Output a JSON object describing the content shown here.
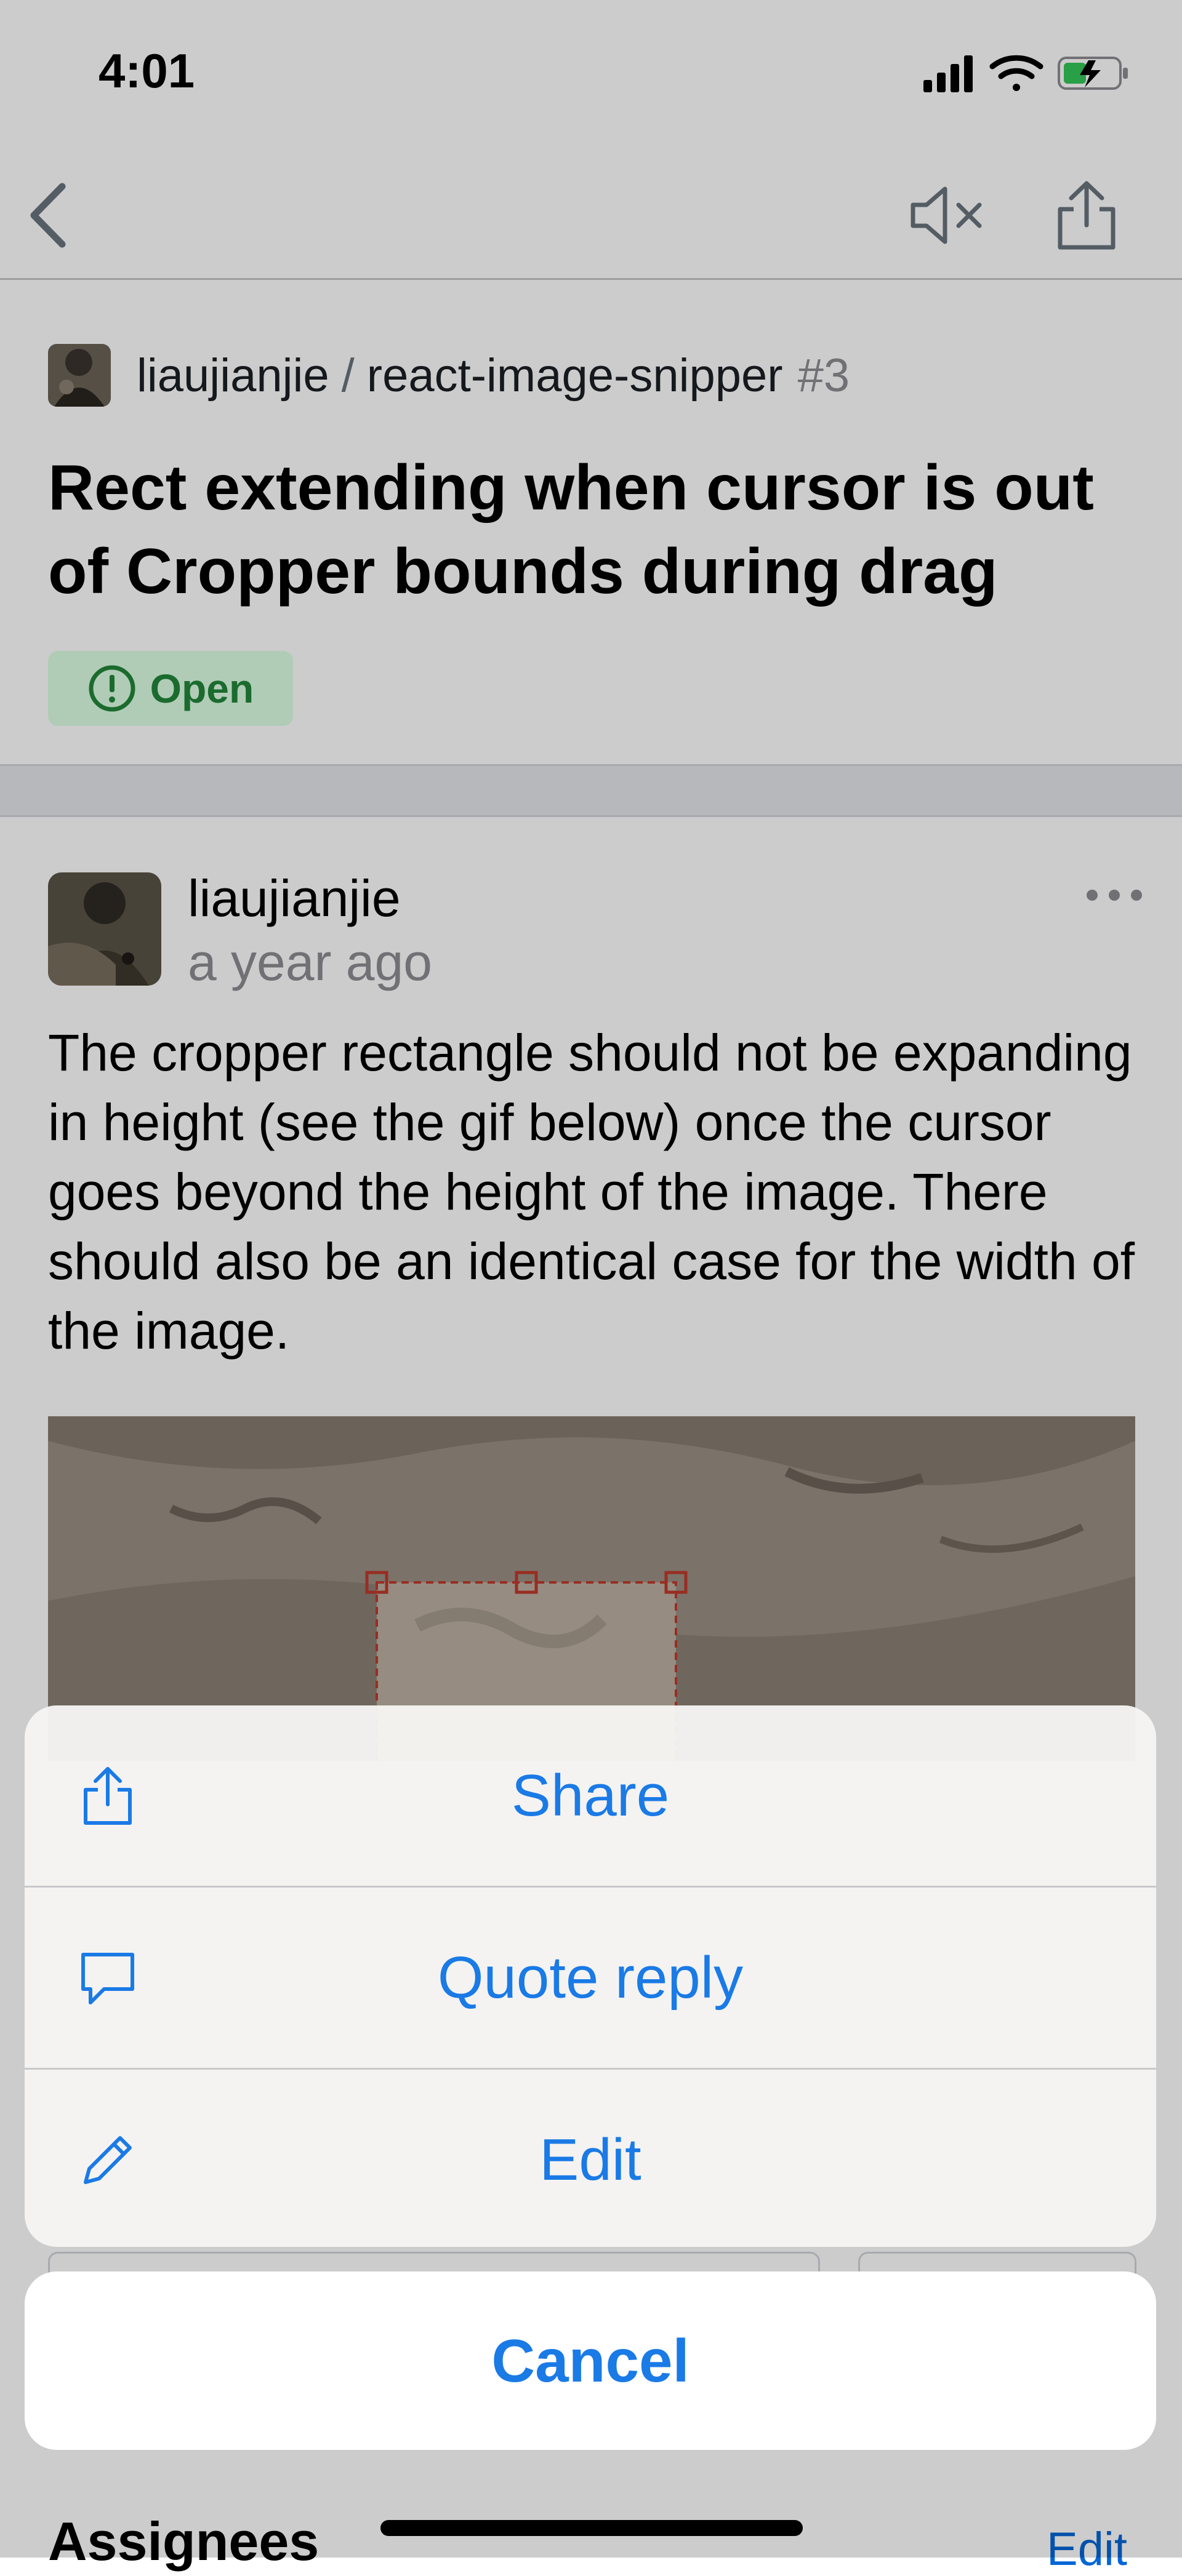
{
  "status": {
    "time": "4:01"
  },
  "nav": {
    "back": "back",
    "mute": "mute",
    "share": "share"
  },
  "issue": {
    "owner": "liaujianjie",
    "separator": "/",
    "repo": "react-image-snipper",
    "number": "#3",
    "title": "Rect extending when cursor is out of Cropper bounds during drag",
    "state": "Open"
  },
  "comment": {
    "author": "liaujianjie",
    "time": "a year ago",
    "body": "The cropper rectangle should not be expanding in height (see the gif below) once the cursor goes beyond the height of the image. There should also be an identical case for the width of the image."
  },
  "sections": {
    "assignees": "Assignees",
    "assignees_edit": "Edit"
  },
  "action_sheet": {
    "items": [
      {
        "label": "Share",
        "icon": "share-icon"
      },
      {
        "label": "Quote reply",
        "icon": "comment-icon"
      },
      {
        "label": "Edit",
        "icon": "pencil-icon"
      }
    ],
    "cancel": "Cancel"
  },
  "colors": {
    "accent": "#1a7ae6",
    "open": "#22863a",
    "open_bg": "#dcffe4"
  }
}
